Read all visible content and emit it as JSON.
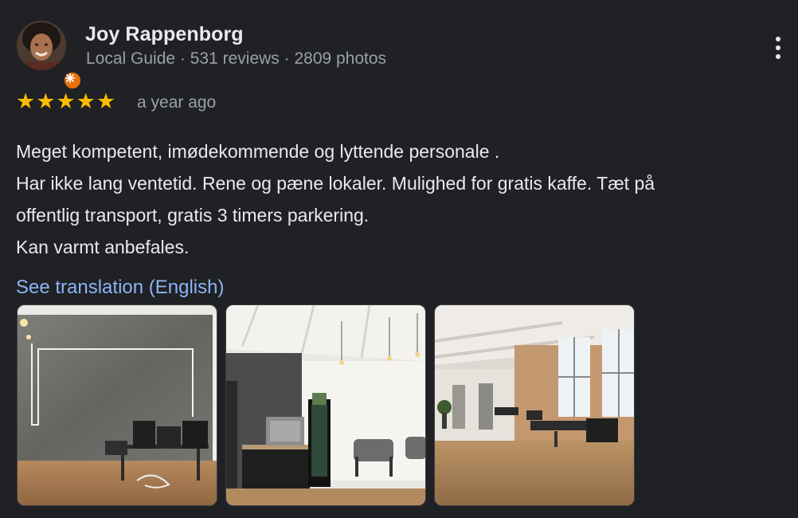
{
  "reviewer": {
    "name": "Joy Rappenborg",
    "meta": "Local Guide · 531 reviews · 2809 photos"
  },
  "rating": {
    "stars": 5,
    "star_glyph": "★",
    "star_color": "#fbbc04"
  },
  "review": {
    "date": "a year ago",
    "lines": [
      "Meget kompetent, imødekommende og lyttende personale .",
      "Har ikke lang ventetid. Rene og pæne lokaler. Mulighed for gratis kaffe. Tæt på",
      "offentlig transport, gratis 3 timers parkering.",
      "Kan varmt anbefales."
    ]
  },
  "translate_link": "See translation (English)",
  "photos": [
    {
      "name": "review-photo-office"
    },
    {
      "name": "review-photo-coffee-area"
    },
    {
      "name": "review-photo-treatment-room"
    }
  ],
  "icons": {
    "more": "more-vert-icon",
    "badge": "local-guide-badge-icon"
  },
  "colors": {
    "background": "#202124",
    "text": "#e8eaed",
    "muted": "#9aa0a6",
    "link": "#8ab4f8",
    "badge": "#e8710a"
  }
}
